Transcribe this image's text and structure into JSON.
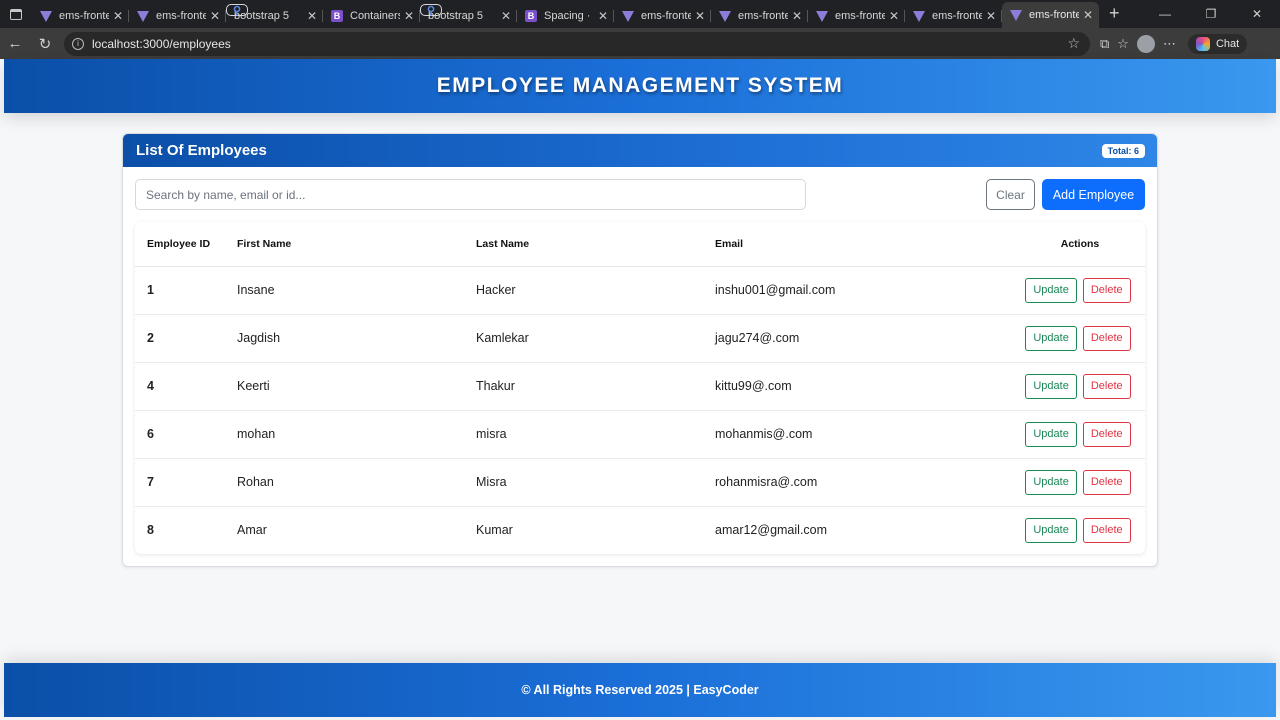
{
  "browser": {
    "tabs": [
      {
        "label": "ems-fronte",
        "icon": "vite-icon"
      },
      {
        "label": "ems-fronte",
        "icon": "vite-icon"
      },
      {
        "label": "bootstrap 5",
        "icon": "search-icon"
      },
      {
        "label": "Containers",
        "icon": "bootstrap-icon"
      },
      {
        "label": "bootstrap 5",
        "icon": "search-icon"
      },
      {
        "label": "Spacing · B",
        "icon": "bootstrap-icon"
      },
      {
        "label": "ems-fronte",
        "icon": "vite-icon"
      },
      {
        "label": "ems-fronte",
        "icon": "vite-icon"
      },
      {
        "label": "ems-fronte",
        "icon": "vite-icon"
      },
      {
        "label": "ems-fronte",
        "icon": "vite-icon"
      },
      {
        "label": "ems-fronte",
        "icon": "vite-icon"
      }
    ],
    "url": "localhost:3000/employees",
    "chat_label": "Chat"
  },
  "header": {
    "title": "EMPLOYEE MANAGEMENT SYSTEM"
  },
  "card": {
    "title": "List Of Employees",
    "total_badge": "Total: 6",
    "search_placeholder": "Search by name, email or id...",
    "clear_label": "Clear",
    "add_label": "Add Employee"
  },
  "table": {
    "columns": [
      "Employee ID",
      "First Name",
      "Last Name",
      "Email",
      "Actions"
    ],
    "update_label": "Update",
    "delete_label": "Delete",
    "rows": [
      {
        "id": "1",
        "first": "Insane",
        "last": "Hacker",
        "email": "inshu001@gmail.com"
      },
      {
        "id": "2",
        "first": "Jagdish",
        "last": "Kamlekar",
        "email": "jagu274@.com"
      },
      {
        "id": "4",
        "first": "Keerti",
        "last": "Thakur",
        "email": "kittu99@.com"
      },
      {
        "id": "6",
        "first": "mohan",
        "last": "misra",
        "email": "mohanmis@.com"
      },
      {
        "id": "7",
        "first": "Rohan",
        "last": "Misra",
        "email": "rohanmisra@.com"
      },
      {
        "id": "8",
        "first": "Amar",
        "last": "Kumar",
        "email": "amar12@gmail.com"
      }
    ]
  },
  "footer": {
    "text": "© All Rights Reserved 2025 | EasyCoder"
  },
  "colors": {
    "primary": "#0d6efd",
    "header_dark": "#0b4fa8",
    "success": "#198754",
    "danger": "#dc3545"
  }
}
